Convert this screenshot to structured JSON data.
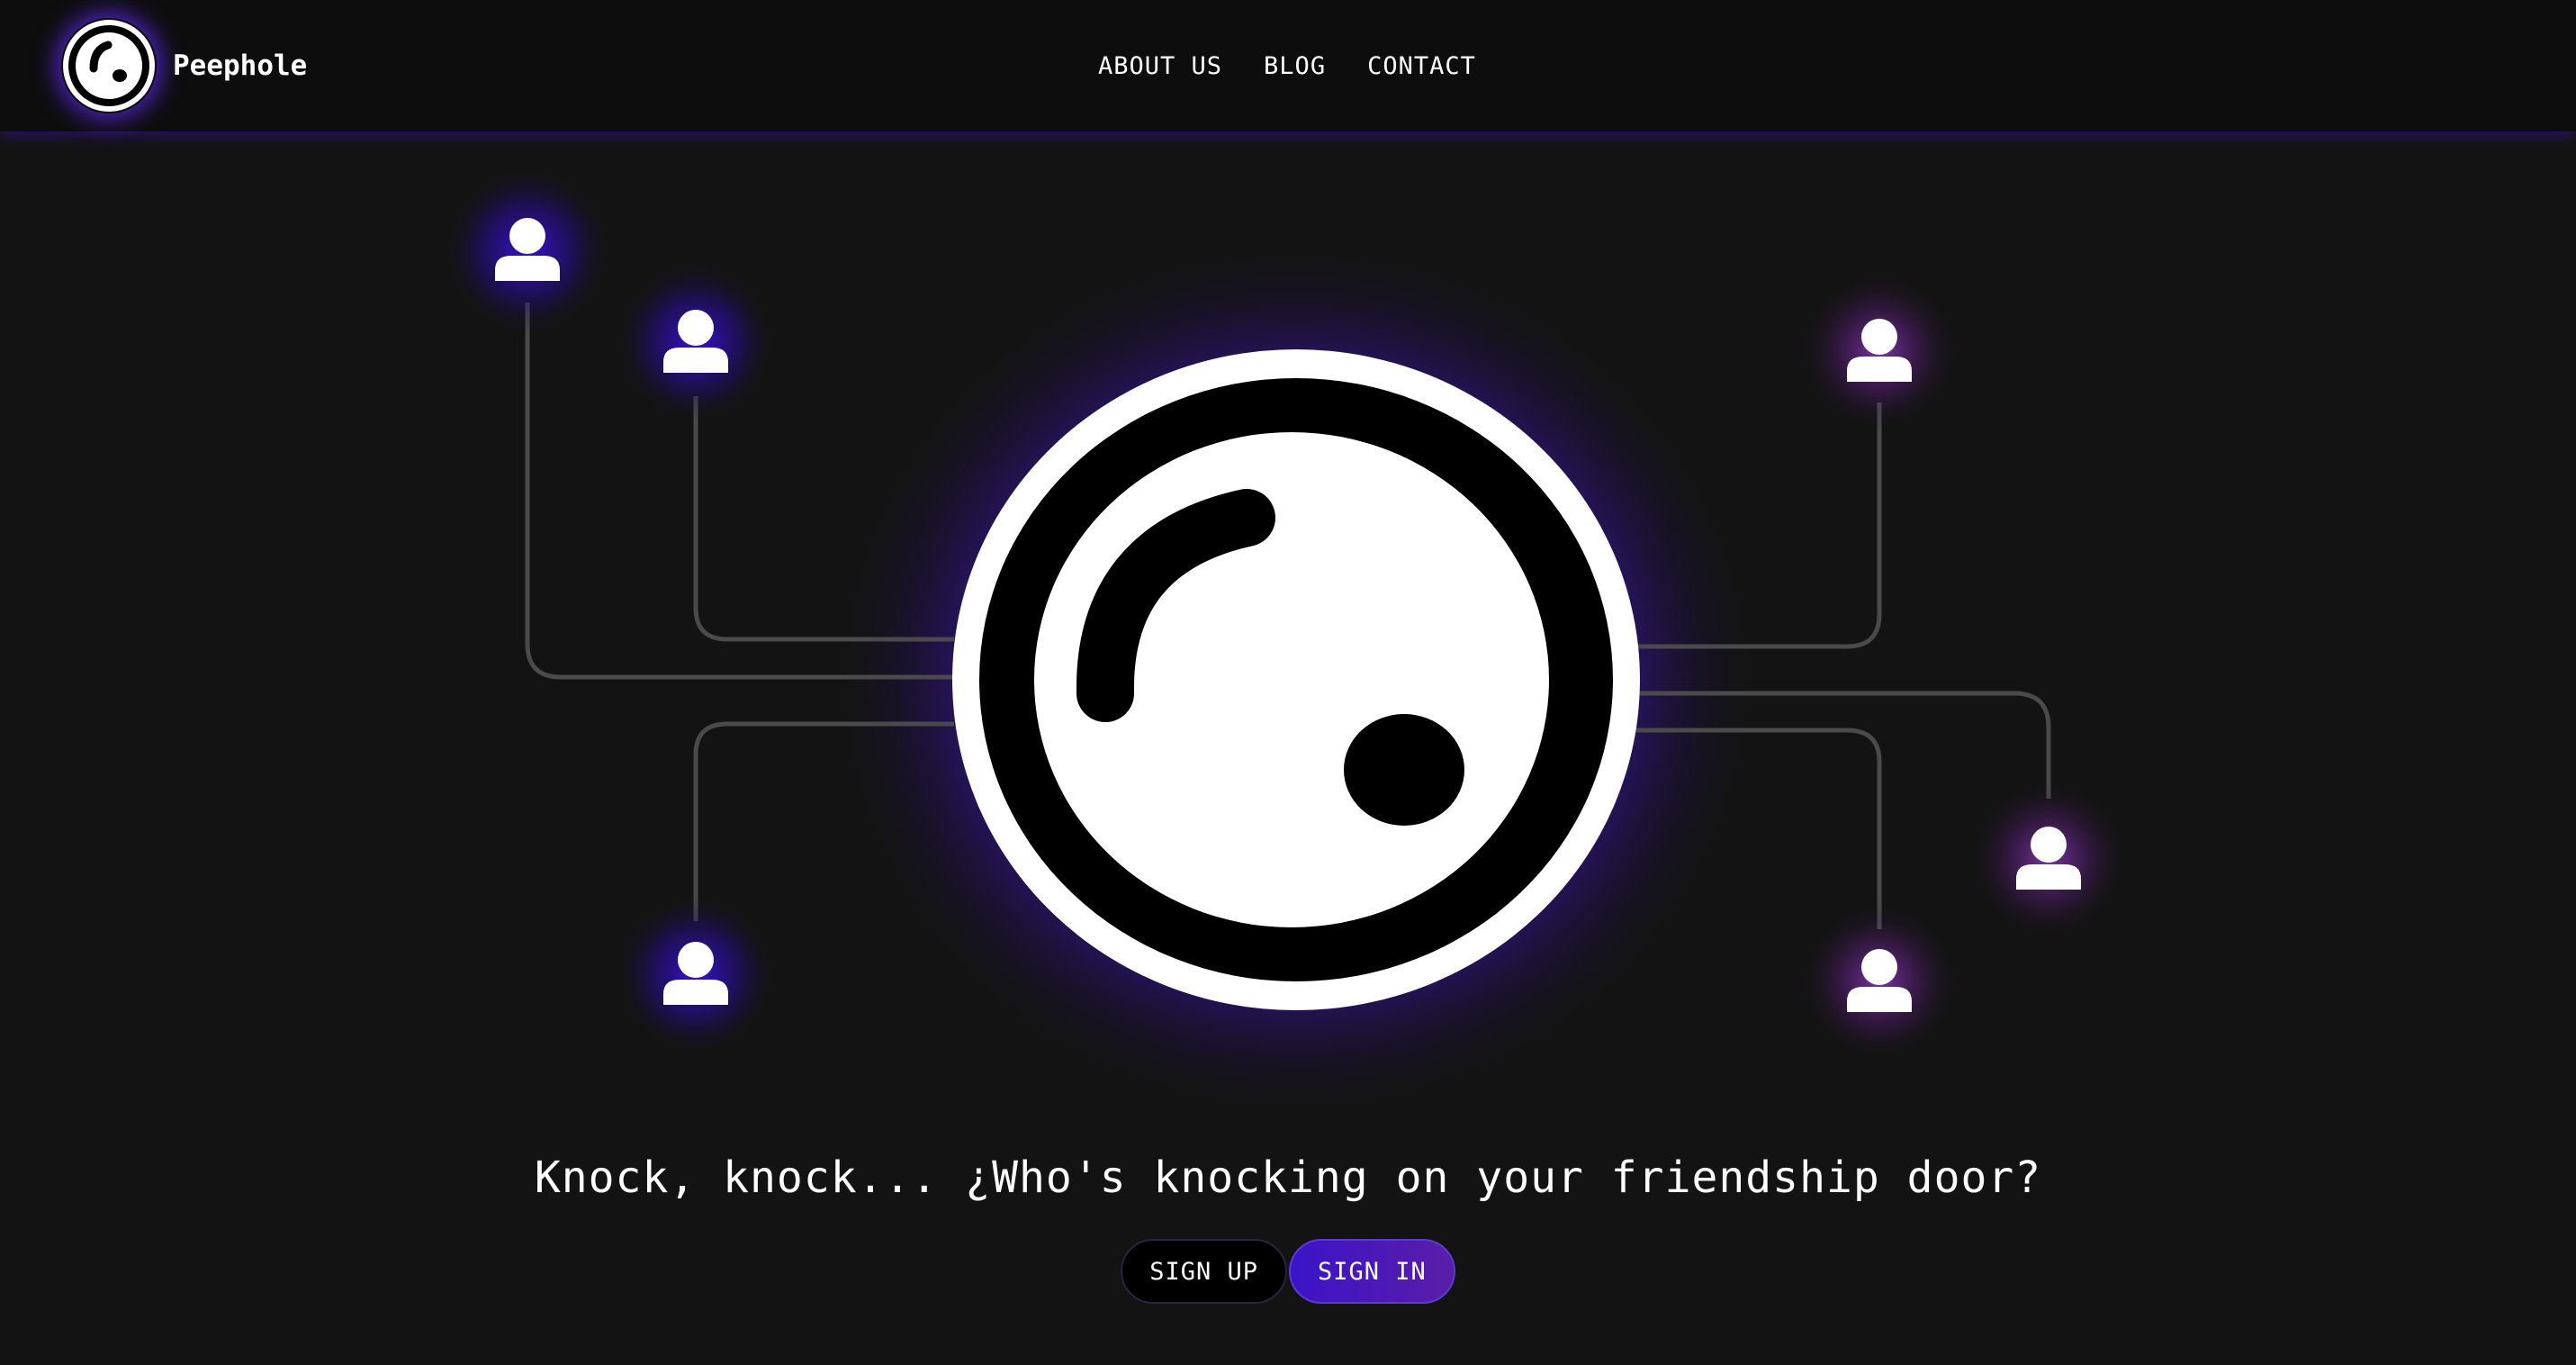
{
  "brand": {
    "name": "Peephole",
    "logo_icon": "peephole-icon"
  },
  "nav": {
    "links": [
      "ABOUT US",
      "BLOG",
      "CONTACT"
    ]
  },
  "hero": {
    "central_icon": "peephole-eye-icon",
    "user_icons": [
      "user-icon",
      "user-icon",
      "user-icon",
      "user-icon",
      "user-icon",
      "user-icon",
      "user-icon"
    ],
    "glow_colors": {
      "left": "#3a10d8",
      "right": "#b040e0"
    }
  },
  "tagline": "Knock, knock... ¿Who's knocking on your friendship door?",
  "actions": {
    "signup_label": "SIGN UP",
    "signin_label": "SIGN IN"
  },
  "colors": {
    "background": "#131313",
    "navbar": "#0d0d0d",
    "accent": "#4a16c8",
    "connector": "#4a4a4a"
  }
}
